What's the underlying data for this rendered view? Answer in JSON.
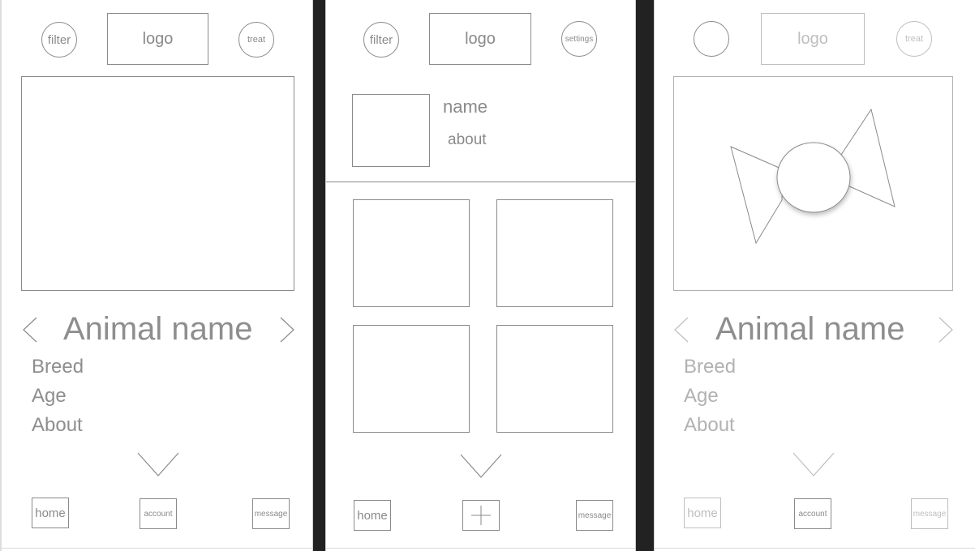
{
  "screens": {
    "swipe": {
      "header": {
        "filter": "filter",
        "logo": "logo",
        "treat": "treat"
      },
      "animal": {
        "name": "Animal name",
        "breed": "Breed",
        "age": "Age",
        "about": "About"
      },
      "nav": {
        "home": "home",
        "account": "account",
        "message": "message"
      }
    },
    "profile": {
      "header": {
        "filter": "filter",
        "logo": "logo",
        "settings": "settings"
      },
      "user": {
        "name": "name",
        "about": "about"
      },
      "nav": {
        "home": "home",
        "message": "message"
      }
    },
    "treat": {
      "header": {
        "logo": "logo",
        "treat": "treat"
      },
      "animal": {
        "name": "Animal name",
        "breed": "Breed",
        "age": "Age",
        "about": "About"
      },
      "nav": {
        "home": "home",
        "account": "account",
        "message": "message"
      }
    }
  }
}
